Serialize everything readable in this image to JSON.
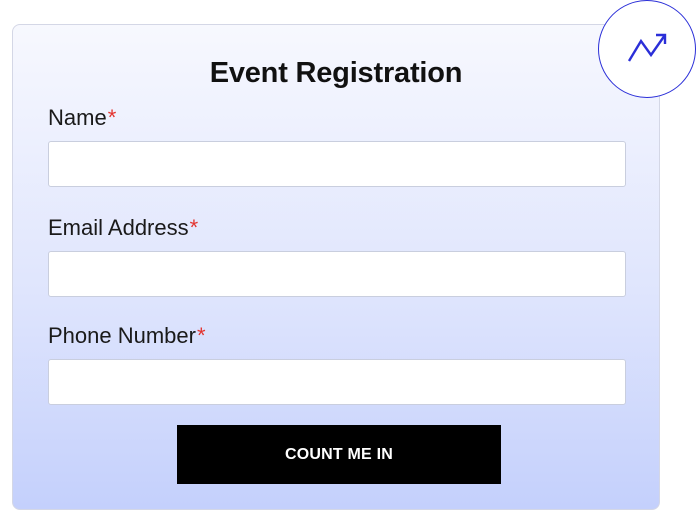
{
  "form": {
    "title": "Event Registration",
    "required_marker": "*",
    "fields": [
      {
        "label": "Name",
        "value": "",
        "placeholder": ""
      },
      {
        "label": "Email Address",
        "value": "",
        "placeholder": ""
      },
      {
        "label": "Phone Number",
        "value": "",
        "placeholder": ""
      }
    ],
    "submit_label": "COUNT ME IN"
  },
  "badge": {
    "icon": "trending-up-icon"
  },
  "colors": {
    "accent": "#2b2fd8",
    "required": "#e3342f",
    "button": "#000000",
    "gradient_top": "#f7f8fe",
    "gradient_bottom": "#c4d0fc"
  }
}
